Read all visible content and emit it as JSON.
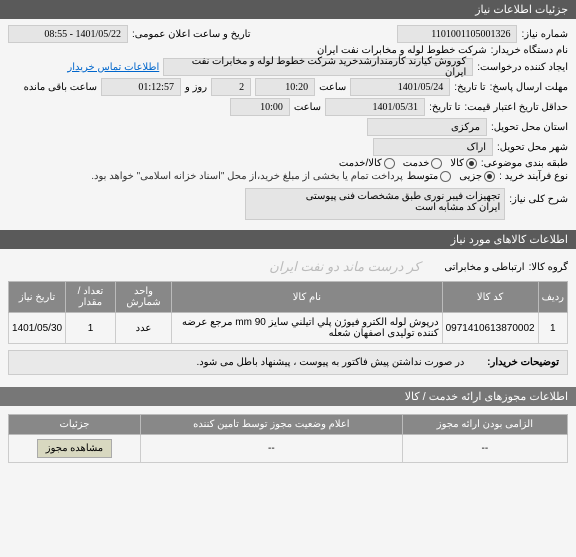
{
  "header": {
    "title": "جزئیات اطلاعات نیاز"
  },
  "form": {
    "needNo": {
      "label": "شماره نیاز:",
      "value": "1101001105001326"
    },
    "announce": {
      "label": "تاریخ و ساعت اعلان عمومی:",
      "value": "1401/05/22 - 08:55"
    },
    "buyerOrg": {
      "label": "نام دستگاه خریدار:",
      "value": "شرکت خطوط لوله و مخابرات نفت ایران"
    },
    "creator": {
      "label": "ایجاد کننده درخواست:",
      "value": "کوروش کیارند کارمندارشدخرید شرکت خطوط لوله و مخابرات نفت ایران"
    },
    "contactLink": "اطلاعات تماس خریدار",
    "responseDeadline": {
      "label": "مهلت ارسال پاسخ:",
      "dateLabel": "تا تاریخ:",
      "date": "1401/05/24",
      "timeLabel": "ساعت",
      "time": "10:20",
      "days": "2",
      "daysLabel": "روز و",
      "remain": "01:12:57",
      "remainLabel": "ساعت باقی مانده"
    },
    "validity": {
      "label": "حداقل تاریخ اعتبار قیمت:",
      "dateLabel": "تا تاریخ:",
      "date": "1401/05/31",
      "timeLabel": "ساعت",
      "time": "10:00"
    },
    "province": {
      "label": "استان محل تحویل:",
      "value": "مرکزی"
    },
    "city": {
      "label": "شهر محل تحویل:",
      "value": "اراک"
    },
    "subjectClass": {
      "label": "طبقه بندی موضوعی:",
      "options": [
        {
          "label": "کالا",
          "checked": true
        },
        {
          "label": "خدمت",
          "checked": false
        },
        {
          "label": "کالا/خدمت",
          "checked": false
        }
      ]
    },
    "buyProcess": {
      "label": "نوع فرآیند خرید :",
      "options": [
        {
          "label": "جزیی",
          "checked": true
        },
        {
          "label": "متوسط",
          "checked": false
        }
      ],
      "note": "پرداخت تمام یا بخشی از مبلغ خرید،از محل \"اسناد خزانه اسلامی\" خواهد بود."
    },
    "needDesc": {
      "label": "شرح کلی نیاز:",
      "text": "تجهیزات فیبر نوری طبق مشخصات فنی پیوستی\nایران کد مشابه است"
    }
  },
  "itemsSection": {
    "title": "اطلاعات کالاهای مورد نیاز"
  },
  "group": {
    "label": "گروه کالا:",
    "value": "ارتباطی و مخابراتی",
    "watermark": "کر درست ماند دو نفت ایران"
  },
  "table": {
    "headers": [
      "ردیف",
      "کد کالا",
      "نام کالا",
      "واحد شمارش",
      "تعداد / مقدار",
      "تاریخ نیاز"
    ],
    "rows": [
      {
        "idx": "1",
        "code": "0971410613870002",
        "name": "درپوش لوله الکترو فیوژن پلي اتيلني سایز 90 mm مرجع عرضه کننده تولیدی اصفهان شعله",
        "unit": "عدد",
        "qty": "1",
        "date": "1401/05/30"
      }
    ]
  },
  "buyerNotes": {
    "label": "توضیحات خریدار:",
    "text": "در صورت نداشتن پیش فاکتور به پیوست ، پیشنهاد باطل می شود."
  },
  "licenses": {
    "title": "اطلاعات مجوزهای ارائه خدمت / کالا"
  },
  "statusTable": {
    "headers": [
      "الزامی بودن ارائه مجوز",
      "اعلام وضعیت مجوز توسط تامین کننده",
      "جزئیات"
    ],
    "row": {
      "c1": "--",
      "c2": "--",
      "btn": "مشاهده مجوز"
    }
  }
}
